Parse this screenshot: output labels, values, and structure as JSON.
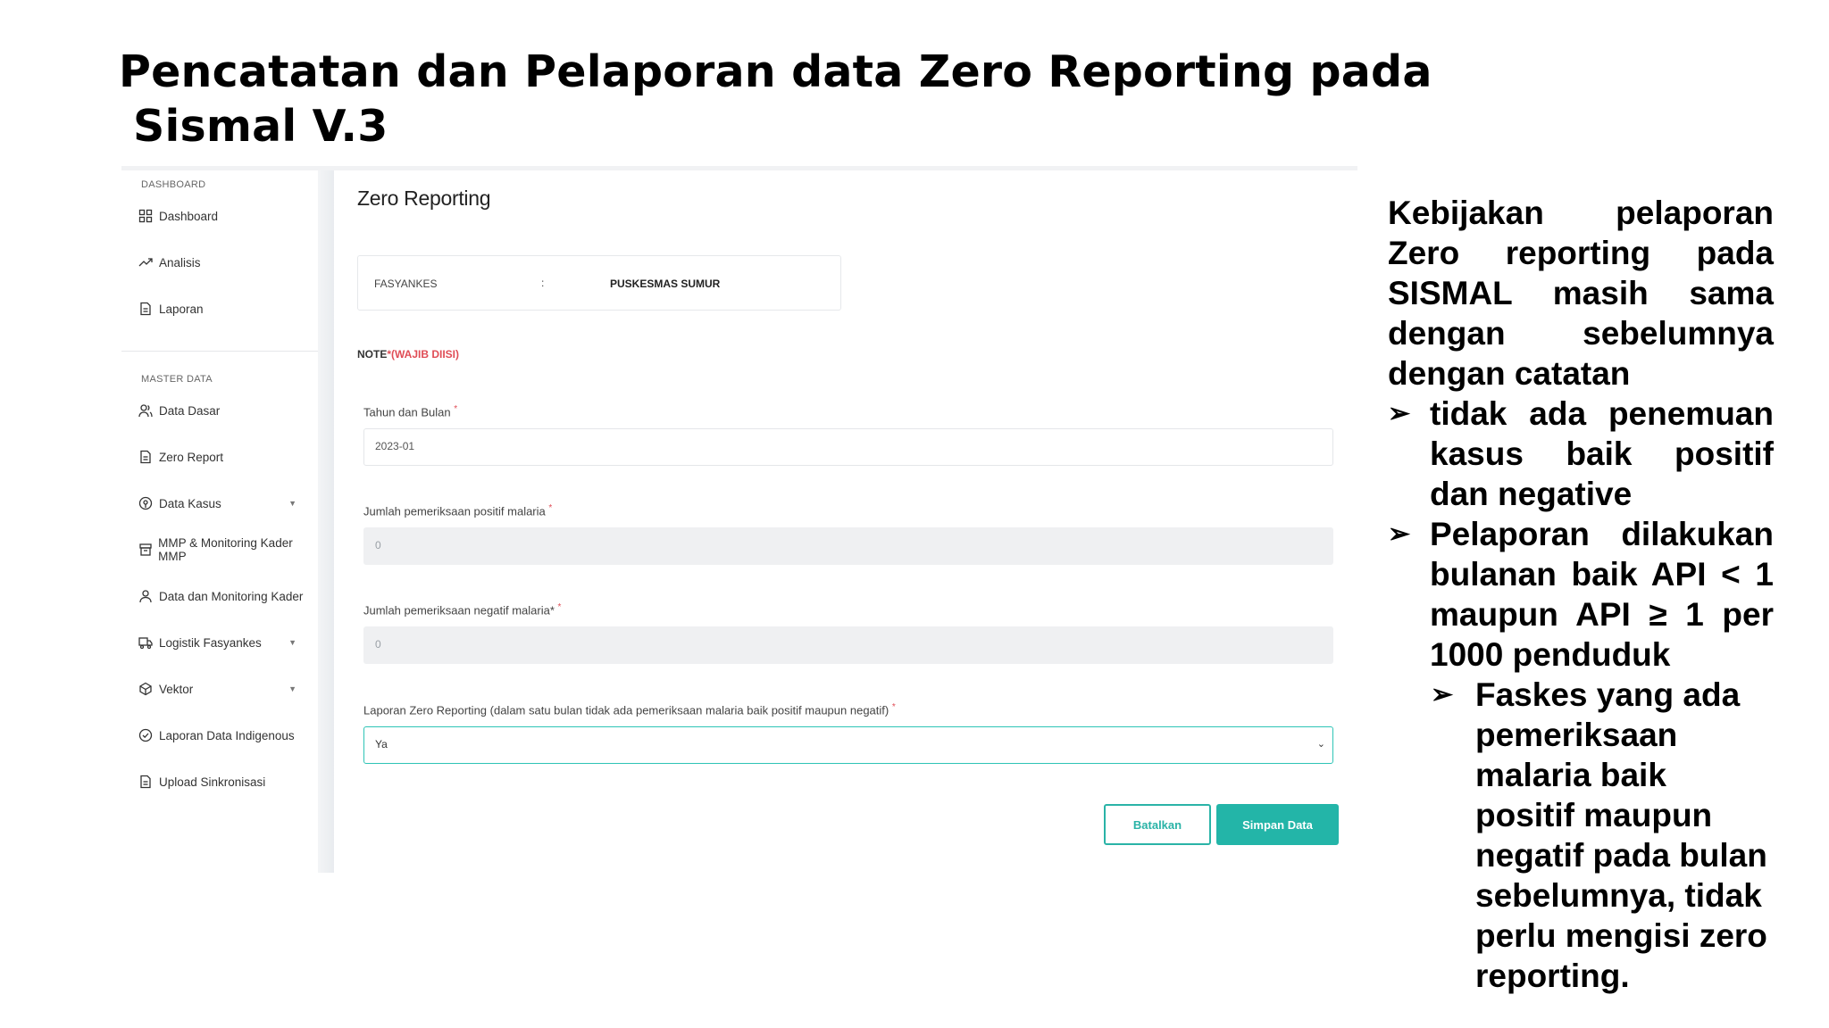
{
  "slide": {
    "title_line1": "Pencatatan dan Pelaporan data Zero Reporting pada",
    "title_line2": "Sismal V.3"
  },
  "sidebar": {
    "section_dashboard": "DASHBOARD",
    "section_master": "MASTER DATA",
    "items": [
      {
        "label": "Dashboard",
        "icon": "grid-icon"
      },
      {
        "label": "Analisis",
        "icon": "trend-icon"
      },
      {
        "label": "Laporan",
        "icon": "document-icon"
      },
      {
        "label": "Data Dasar",
        "icon": "users-icon"
      },
      {
        "label": "Zero Report",
        "icon": "document-icon"
      },
      {
        "label": "Data Kasus",
        "icon": "location-icon",
        "has_submenu": true
      },
      {
        "label": "MMP & Monitoring Kader MMP",
        "icon": "box-icon"
      },
      {
        "label": "Data dan Monitoring Kader",
        "icon": "user-icon"
      },
      {
        "label": "Logistik Fasyankes",
        "icon": "truck-icon",
        "has_submenu": true
      },
      {
        "label": "Vektor",
        "icon": "bug-icon",
        "has_submenu": true
      },
      {
        "label": "Laporan Data Indigenous",
        "icon": "check-circle-icon"
      },
      {
        "label": "Upload Sinkronisasi",
        "icon": "document-icon"
      }
    ]
  },
  "main": {
    "page_title": "Zero Reporting",
    "fasyankes_label": "FASYANKES",
    "fasyankes_colon": ":",
    "fasyankes_value": "PUSKESMAS SUMUR",
    "note_label": "NOTE",
    "note_required": "*(WAJIB DIISI)",
    "fields": {
      "tahun_bulan_label": "Tahun dan Bulan",
      "tahun_bulan_value": "2023-01",
      "positif_label": "Jumlah pemeriksaan positif malaria",
      "positif_value": "0",
      "negatif_label": "Jumlah pemeriksaan negatif malaria*",
      "negatif_value": "0",
      "zero_label": "Laporan Zero Reporting (dalam satu bulan tidak ada pemeriksaan malaria baik positif maupun negatif)",
      "zero_value": "Ya",
      "required_star": "*"
    },
    "buttons": {
      "cancel": "Batalkan",
      "save": "Simpan Data"
    }
  },
  "policy": {
    "intro": "Kebijakan pelaporan Zero reporting pada SISMAL masih sama dengan sebelumnya dengan catatan",
    "bullet1": "tidak ada penemuan kasus baik positif dan negative",
    "bullet2": "Pelaporan dilakukan bulanan baik API < 1 maupun API ≥ 1 per 1000 penduduk",
    "bullet3": "Faskes yang ada pemeriksaan malaria baik positif maupun negatif pada bulan sebelumnya, tidak perlu mengisi zero reporting."
  },
  "colors": {
    "accent": "#23b5a8",
    "required": "#e04d56",
    "disabled_bg": "#eff0f2"
  }
}
